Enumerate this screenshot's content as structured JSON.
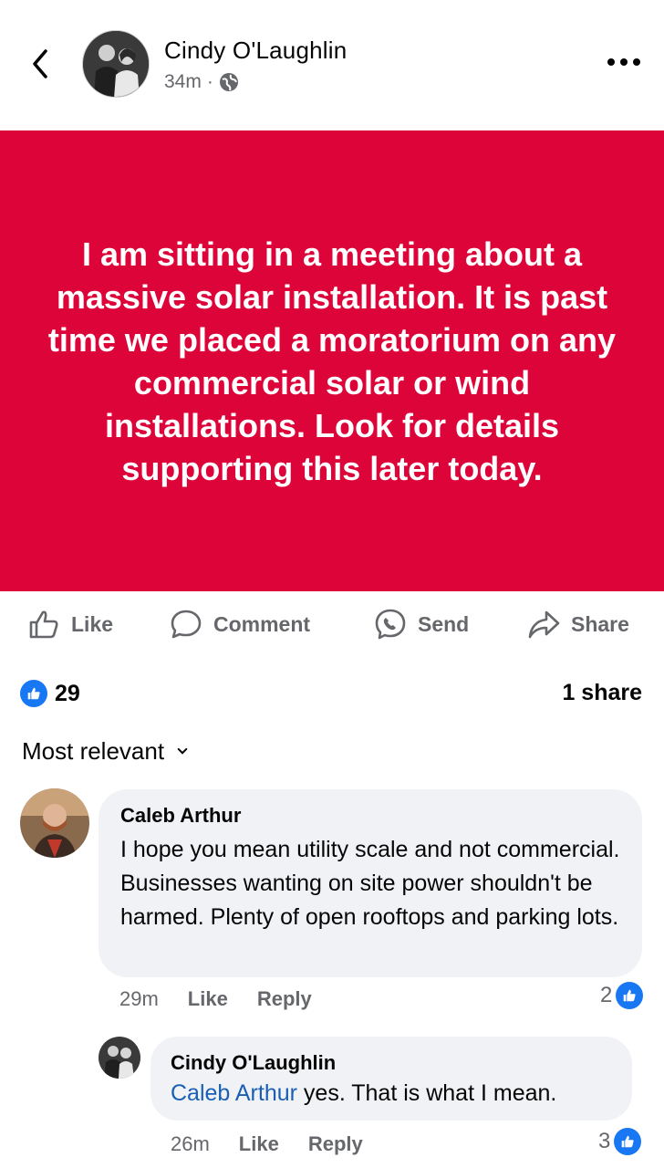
{
  "header": {
    "author": "Cindy O'Laughlin",
    "time": "34m",
    "separator": "·"
  },
  "post": {
    "text": "I am sitting in a meeting about a massive solar installation. It is past time we placed a moratorium on any commercial solar or wind installations. Look for details supporting this later today.",
    "background_color": "#dc0438"
  },
  "actions": {
    "like": "Like",
    "comment": "Comment",
    "send": "Send",
    "share": "Share"
  },
  "summary": {
    "likes": "29",
    "shares": "1 share"
  },
  "sort": {
    "label": "Most relevant"
  },
  "comments": [
    {
      "author": "Caleb Arthur",
      "text": "I hope you mean utility scale and not commercial. Businesses wanting on site power shouldn't be harmed. Plenty of open rooftops and parking lots.",
      "time": "29m",
      "like": "Like",
      "reply": "Reply",
      "reactions": "2"
    },
    {
      "author": "Cindy O'Laughlin",
      "mention": "Caleb Arthur",
      "text": " yes. That is what I mean.",
      "time": "26m",
      "like": "Like",
      "reply": "Reply",
      "reactions": "3"
    }
  ],
  "icons": {
    "back": "chevron-left-icon",
    "globe": "globe-icon",
    "more": "more-dots-icon",
    "like": "thumbs-up-icon",
    "comment": "comment-bubble-icon",
    "send": "messenger-icon",
    "share": "share-arrow-icon",
    "caret": "chevron-down-icon"
  },
  "colors": {
    "accent": "#1877f2",
    "mention": "#1a5fb4",
    "muted": "#65676b",
    "bubble": "#f0f2f5"
  }
}
